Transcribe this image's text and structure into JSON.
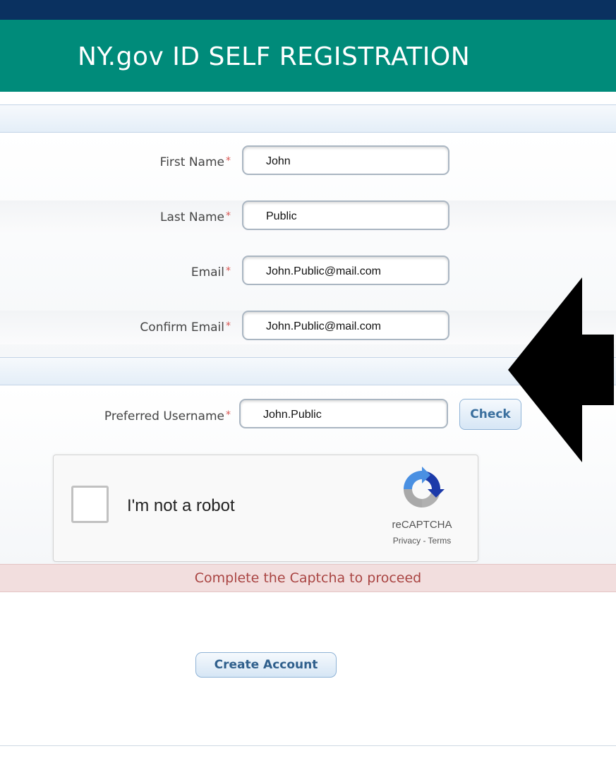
{
  "header": {
    "title": "NY.gov ID SELF REGISTRATION"
  },
  "form": {
    "required_marker": "*",
    "first_name": {
      "label": "First Name",
      "value": "John"
    },
    "last_name": {
      "label": "Last Name",
      "value": "Public"
    },
    "email": {
      "label": "Email",
      "value": "John.Public@mail.com"
    },
    "confirm_email": {
      "label": "Confirm Email",
      "value": "John.Public@mail.com"
    },
    "username": {
      "label": "Preferred Username",
      "value": "John.Public"
    },
    "check_label": "Check"
  },
  "captcha": {
    "label": "I'm not a robot",
    "brand": "reCAPTCHA",
    "links": "Privacy - Terms",
    "checked": false
  },
  "alert": {
    "message": "Complete the Captcha to proceed"
  },
  "actions": {
    "create_account_label": "Create Account"
  },
  "colors": {
    "topbar": "#0a3160",
    "header": "#008b7a",
    "required": "#d9534f",
    "alert_bg": "#f2dede",
    "alert_text": "#a94442",
    "button_text": "#3a6f9e"
  },
  "icons": {
    "annotation_arrow": "black-arrow-left-icon",
    "captcha_logo": "recaptcha-logo-icon"
  }
}
